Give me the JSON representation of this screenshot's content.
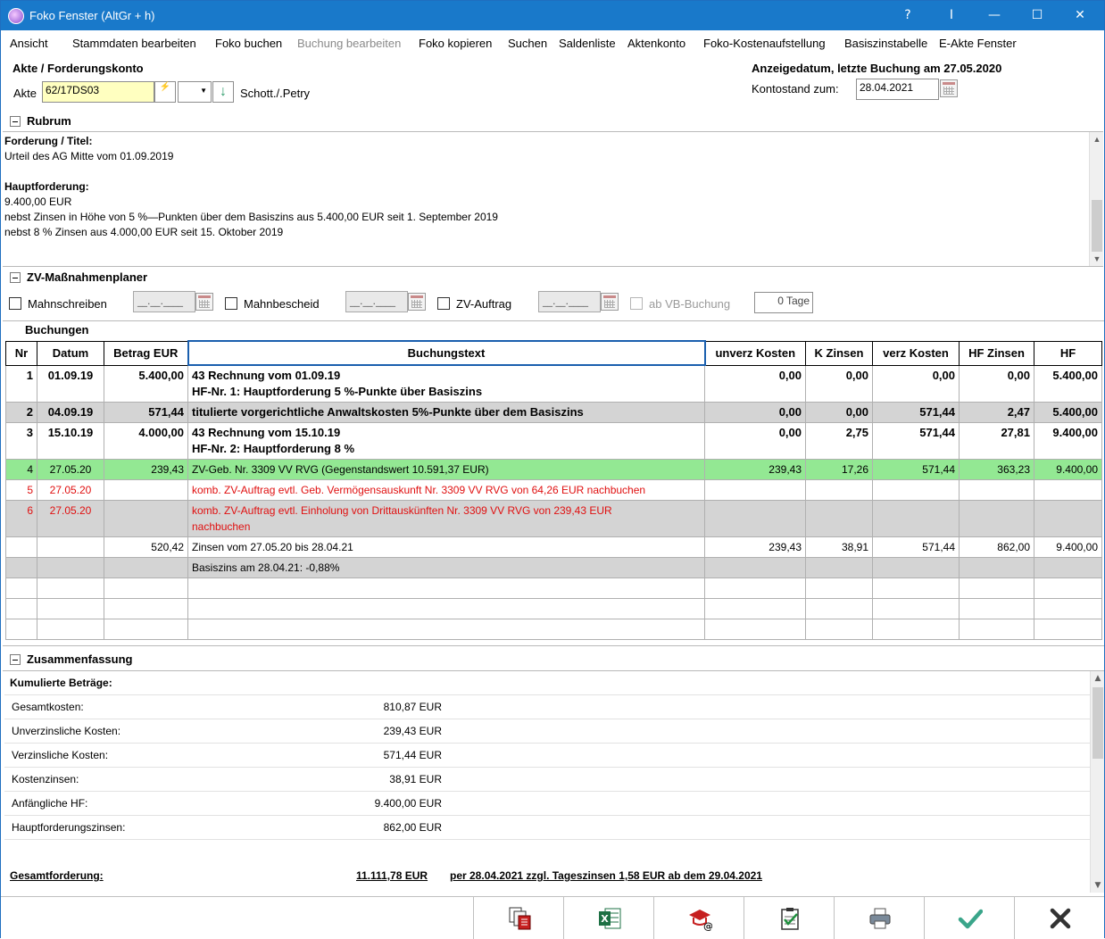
{
  "window": {
    "title": "Foko Fenster (AltGr + h)",
    "help": "?",
    "cursor": "I",
    "minimize": "—",
    "maximize": "☐",
    "close": "✕"
  },
  "menu": [
    "Ansicht",
    "Stammdaten bearbeiten",
    "Foko buchen",
    "Buchung bearbeiten",
    "Foko kopieren",
    "Suchen",
    "Saldenliste",
    "Aktenkonto",
    "Foko-Kostenaufstellung",
    "Basiszinstabelle",
    "E-Akte Fenster"
  ],
  "header": {
    "section_title": "Akte / Forderungskonto",
    "akte_label": "Akte",
    "akte_value": "62/17DS03",
    "akte_name": "Schott./.Petry",
    "anzeige": "Anzeigedatum, letzte Buchung am 27.05.2020",
    "kontostand_label": "Kontostand zum:",
    "kontostand_value": "28.04.2021"
  },
  "rubrum": {
    "title": "Rubrum",
    "lines": [
      {
        "text": "Forderung / Titel:",
        "bold": true
      },
      {
        "text": "Urteil des AG Mitte vom 01.09.2019",
        "bold": false
      },
      {
        "text": "",
        "bold": false
      },
      {
        "text": "Hauptforderung:",
        "bold": true
      },
      {
        "text": "9.400,00 EUR",
        "bold": false
      },
      {
        "text": "nebst Zinsen in Höhe von 5 %—Punkten über dem Basiszins aus 5.400,00 EUR seit 1. September 2019",
        "bold": false
      },
      {
        "text": "nebst 8 % Zinsen aus 4.000,00 EUR seit 15. Oktober 2019",
        "bold": false
      }
    ]
  },
  "zv": {
    "title": "ZV-Maßnahmenplaner",
    "mahnschreiben": "Mahnschreiben",
    "mahnbescheid": "Mahnbescheid",
    "zv_auftrag": "ZV-Auftrag",
    "ab_vb": "ab VB-Buchung",
    "date_placeholder": "__.__.____",
    "tage": "0 Tage"
  },
  "buchungen": {
    "title": "Buchungen",
    "columns": [
      "Nr",
      "Datum",
      "Betrag EUR",
      "Buchungstext",
      "unverz Kosten",
      "K Zinsen",
      "verz Kosten",
      "HF Zinsen",
      "HF"
    ],
    "rows": [
      {
        "style": "bold",
        "cells": [
          "1",
          "01.09.19",
          "5.400,00",
          "43 Rechnung vom 01.09.19\nHF-Nr. 1: Hauptforderung 5 %-Punkte über Basiszins",
          "0,00",
          "0,00",
          "0,00",
          "0,00",
          "5.400,00"
        ]
      },
      {
        "style": "bold gray",
        "cells": [
          "2",
          "04.09.19",
          "571,44",
          "titulierte vorgerichtliche Anwaltskosten 5%-Punkte über dem Basiszins",
          "0,00",
          "0,00",
          "571,44",
          "2,47",
          "5.400,00"
        ]
      },
      {
        "style": "bold",
        "cells": [
          "3",
          "15.10.19",
          "4.000,00",
          "43 Rechnung vom 15.10.19\nHF-Nr. 2: Hauptforderung 8 %",
          "0,00",
          "2,75",
          "571,44",
          "27,81",
          "9.400,00"
        ]
      },
      {
        "style": "green",
        "cells": [
          "4",
          "27.05.20",
          "239,43",
          "ZV-Geb. Nr. 3309 VV RVG (Gegenstandswert 10.591,37 EUR)",
          "239,43",
          "17,26",
          "571,44",
          "363,23",
          "9.400,00"
        ]
      },
      {
        "style": "red",
        "cells": [
          "5",
          "27.05.20",
          "",
          "komb. ZV-Auftrag evtl. Geb. Vermögensauskunft Nr. 3309 VV RVG von 64,26 EUR nachbuchen",
          "",
          "",
          "",
          "",
          ""
        ]
      },
      {
        "style": "red gray",
        "cells": [
          "6",
          "27.05.20",
          "",
          "komb. ZV-Auftrag evtl. Einholung von Drittauskünften Nr. 3309 VV RVG von 239,43 EUR\nnachbuchen",
          "",
          "",
          "",
          "",
          ""
        ]
      },
      {
        "style": "",
        "cells": [
          "",
          "",
          "520,42",
          "Zinsen vom 27.05.20 bis 28.04.21",
          "239,43",
          "38,91",
          "571,44",
          "862,00",
          "9.400,00"
        ]
      },
      {
        "style": "gray",
        "cells": [
          "",
          "",
          "",
          "Basiszins am 28.04.21: -0,88%",
          "",
          "",
          "",
          "",
          ""
        ]
      }
    ]
  },
  "zusammenfassung": {
    "title": "Zusammenfassung",
    "heading": "Kumulierte Beträge:",
    "items": [
      {
        "label": "Gesamtkosten:",
        "value": "810,87 EUR"
      },
      {
        "label": "Unverzinsliche Kosten:",
        "value": "239,43 EUR"
      },
      {
        "label": "Verzinsliche Kosten:",
        "value": "571,44 EUR"
      },
      {
        "label": "Kostenzinsen:",
        "value": "38,91 EUR"
      },
      {
        "label": "Anfängliche HF:",
        "value": "9.400,00 EUR"
      },
      {
        "label": "Hauptforderungszinsen:",
        "value": "862,00 EUR"
      }
    ],
    "total_label": "Gesamtforderung:",
    "total_value": "11.111,78 EUR",
    "total_note": "per 28.04.2021 zzgl. Tageszinsen 1,58 EUR ab dem 29.04.2021"
  },
  "toolbar": [
    "copy-documents-icon",
    "excel-icon",
    "email-icon",
    "clipboard-check-icon",
    "printer-icon",
    "confirm-check-icon",
    "cancel-x-icon"
  ],
  "colors": {
    "titlebar": "#1979ca",
    "green_row": "#93e893",
    "gray_row": "#d4d4d4",
    "red_text": "#e01010",
    "akte_field": "#ffffc0"
  }
}
